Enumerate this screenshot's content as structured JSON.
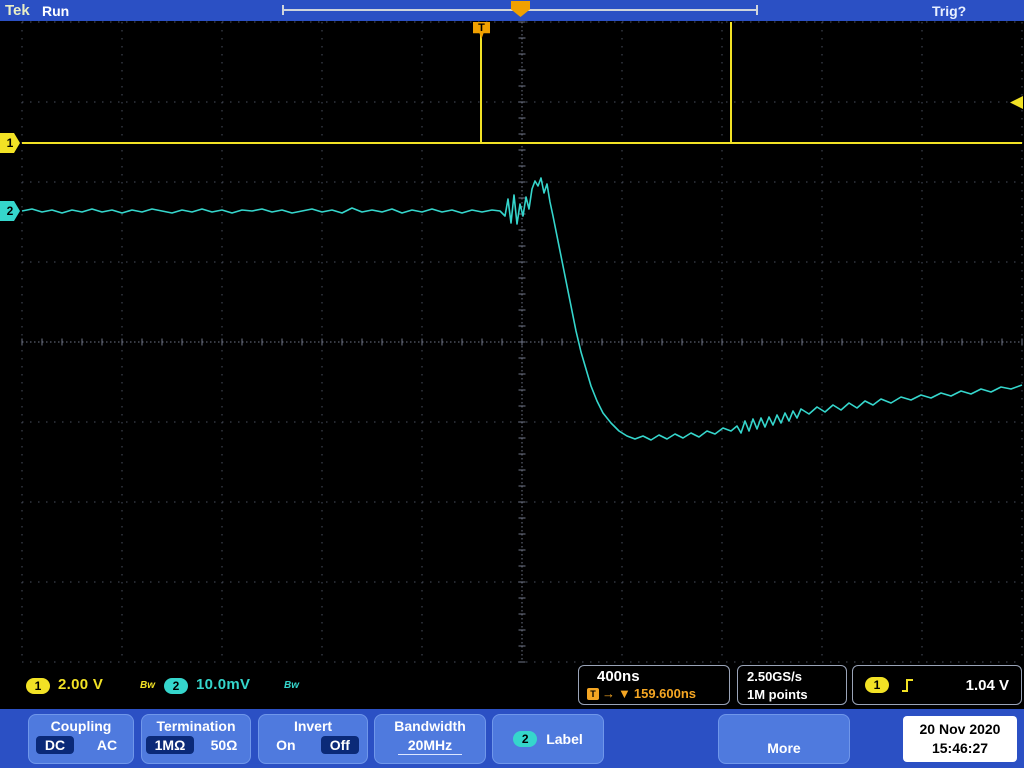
{
  "topbar": {
    "logo": "Tek",
    "run": "Run",
    "trig": "Trig?"
  },
  "channels": {
    "ch1": {
      "label": "1",
      "scale": "2.00 V",
      "bw_indicator": "Bw",
      "color": "#f2e225"
    },
    "ch2": {
      "label": "2",
      "scale": "10.0mV",
      "bw_indicator": "Bw",
      "color": "#35d6cc"
    }
  },
  "horizontal": {
    "scale": "400ns",
    "trigger_t": "T",
    "arrow": "→",
    "down_triangle": "▼",
    "delay": "159.600ns",
    "sample_rate": "2.50GS/s",
    "record_length": "1M points"
  },
  "trigger": {
    "source": "1",
    "level": "1.04 V"
  },
  "menu": {
    "coupling": {
      "title": "Coupling",
      "options": [
        {
          "label": "DC",
          "selected": true
        },
        {
          "label": "AC",
          "selected": false
        }
      ]
    },
    "termination": {
      "title": "Termination",
      "options": [
        {
          "label": "1MΩ",
          "selected": true
        },
        {
          "label": "50Ω",
          "selected": false
        }
      ]
    },
    "invert": {
      "title": "Invert",
      "options": [
        {
          "label": "On",
          "selected": false
        },
        {
          "label": "Off",
          "selected": true
        }
      ]
    },
    "bandwidth": {
      "title": "Bandwidth",
      "value": "20MHz"
    },
    "label": {
      "channel": "2",
      "title": "Label"
    },
    "more": {
      "title": "More"
    },
    "datetime": {
      "date": "20 Nov 2020",
      "time": "15:46:27"
    }
  },
  "waveforms": {
    "ch1": {
      "color": "#f2e225",
      "width": 2,
      "segments": [
        [
          [
            22,
            143
          ],
          [
            1022,
            143
          ]
        ],
        [
          [
            481,
            143
          ],
          [
            481,
            33
          ]
        ],
        [
          [
            731,
            143
          ],
          [
            731,
            22
          ]
        ]
      ]
    },
    "ch2": {
      "color": "#35d6cc",
      "width": 1.6,
      "segments": [
        [
          [
            22,
            211
          ],
          [
            32,
            209
          ],
          [
            42,
            212
          ],
          [
            52,
            210
          ],
          [
            62,
            213
          ],
          [
            72,
            210
          ],
          [
            82,
            212
          ],
          [
            92,
            209
          ],
          [
            102,
            212
          ],
          [
            112,
            210
          ],
          [
            122,
            213
          ],
          [
            132,
            210
          ],
          [
            142,
            212
          ],
          [
            152,
            209
          ],
          [
            162,
            211
          ],
          [
            172,
            213
          ],
          [
            182,
            210
          ],
          [
            192,
            212
          ],
          [
            202,
            209
          ],
          [
            212,
            212
          ],
          [
            222,
            210
          ],
          [
            232,
            213
          ],
          [
            242,
            210
          ],
          [
            252,
            211
          ],
          [
            262,
            209
          ],
          [
            272,
            212
          ],
          [
            282,
            210
          ],
          [
            292,
            213
          ],
          [
            302,
            211
          ],
          [
            312,
            209
          ],
          [
            322,
            212
          ],
          [
            332,
            210
          ],
          [
            342,
            213
          ],
          [
            352,
            208
          ],
          [
            362,
            212
          ],
          [
            372,
            210
          ],
          [
            382,
            212
          ],
          [
            392,
            209
          ],
          [
            402,
            213
          ],
          [
            412,
            210
          ],
          [
            422,
            212
          ],
          [
            432,
            209
          ],
          [
            442,
            212
          ],
          [
            452,
            210
          ],
          [
            462,
            213
          ],
          [
            472,
            210
          ],
          [
            482,
            212
          ],
          [
            492,
            210
          ],
          [
            500,
            211
          ],
          [
            505,
            216
          ],
          [
            508,
            199
          ],
          [
            511,
            223
          ],
          [
            514,
            195
          ],
          [
            517,
            224
          ],
          [
            520,
            204
          ],
          [
            523,
            216
          ],
          [
            526,
            197
          ],
          [
            529,
            209
          ],
          [
            532,
            189
          ],
          [
            535,
            181
          ],
          [
            538,
            186
          ],
          [
            541,
            178
          ],
          [
            544,
            193
          ],
          [
            547,
            184
          ],
          [
            550,
            202
          ],
          [
            553,
            216
          ],
          [
            557,
            236
          ],
          [
            561,
            256
          ],
          [
            566,
            281
          ],
          [
            571,
            306
          ],
          [
            576,
            331
          ],
          [
            581,
            352
          ],
          [
            586,
            369
          ],
          [
            591,
            386
          ],
          [
            597,
            401
          ],
          [
            603,
            413
          ],
          [
            611,
            423
          ],
          [
            619,
            431
          ],
          [
            627,
            436
          ],
          [
            635,
            439
          ],
          [
            643,
            436
          ],
          [
            651,
            440
          ],
          [
            659,
            435
          ],
          [
            667,
            439
          ],
          [
            675,
            434
          ],
          [
            683,
            438
          ],
          [
            691,
            433
          ],
          [
            699,
            437
          ],
          [
            707,
            431
          ],
          [
            715,
            434
          ],
          [
            723,
            428
          ],
          [
            731,
            431
          ],
          [
            737,
            426
          ],
          [
            741,
            433
          ],
          [
            745,
            421
          ],
          [
            749,
            431
          ],
          [
            753,
            419
          ],
          [
            757,
            429
          ],
          [
            761,
            418
          ],
          [
            765,
            427
          ],
          [
            769,
            417
          ],
          [
            773,
            425
          ],
          [
            777,
            415
          ],
          [
            781,
            423
          ],
          [
            785,
            413
          ],
          [
            789,
            421
          ],
          [
            793,
            411
          ],
          [
            797,
            418
          ],
          [
            801,
            409
          ],
          [
            809,
            414
          ],
          [
            817,
            407
          ],
          [
            825,
            412
          ],
          [
            833,
            405
          ],
          [
            841,
            410
          ],
          [
            849,
            403
          ],
          [
            857,
            408
          ],
          [
            865,
            401
          ],
          [
            873,
            405
          ],
          [
            881,
            399
          ],
          [
            891,
            403
          ],
          [
            901,
            397
          ],
          [
            911,
            400
          ],
          [
            921,
            395
          ],
          [
            931,
            398
          ],
          [
            941,
            393
          ],
          [
            951,
            396
          ],
          [
            961,
            391
          ],
          [
            971,
            394
          ],
          [
            981,
            389
          ],
          [
            991,
            392
          ],
          [
            1001,
            387
          ],
          [
            1011,
            389
          ],
          [
            1022,
            385
          ]
        ]
      ]
    }
  }
}
